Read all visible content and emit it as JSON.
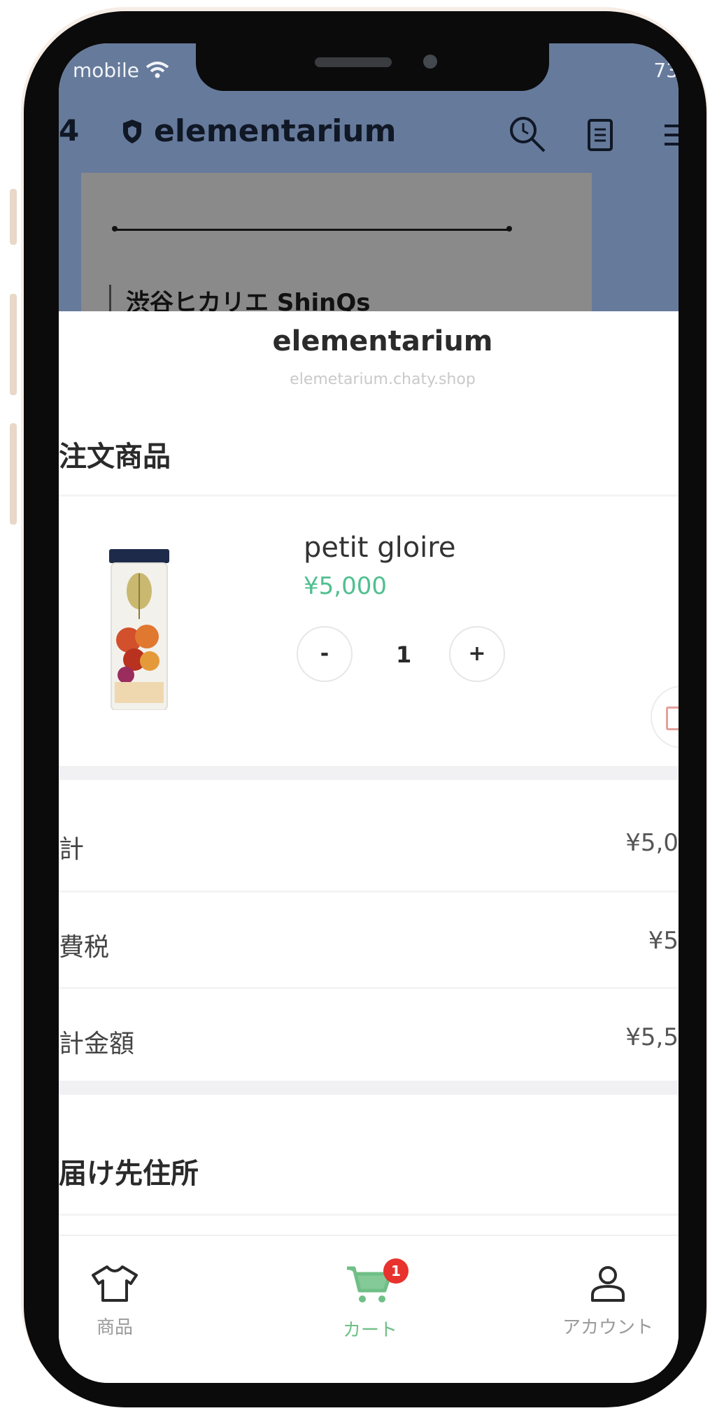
{
  "status_bar": {
    "carrier": "mobile",
    "time": "73"
  },
  "background_app": {
    "back_count": "4",
    "title": "elementarium",
    "card_text": "渋谷ヒカリエ ShinQs"
  },
  "sheet": {
    "shop_name": "elementarium",
    "shop_domain": "elemetarium.chaty.shop",
    "order_section_title": "注文商品",
    "product": {
      "name": "petit gloire",
      "price": "¥5,000",
      "quantity": "1",
      "decrement_label": "-",
      "increment_label": "+"
    },
    "summary": [
      {
        "label": "計",
        "value": "¥5,0"
      },
      {
        "label": "費税",
        "value": "¥5"
      },
      {
        "label": "計金額",
        "value": "¥5,5"
      }
    ],
    "address_section_title": "届け先住所"
  },
  "tabbar": {
    "items": [
      {
        "label": "商品",
        "icon": "shirt-icon"
      },
      {
        "label": "カート",
        "icon": "cart-icon",
        "badge": "1"
      },
      {
        "label": "アカウント",
        "icon": "person-icon"
      }
    ]
  },
  "colors": {
    "price": "#4fbf8f",
    "active_tab": "#6fbf86",
    "badge": "#e8322d",
    "background_dim": "#667a9b"
  }
}
